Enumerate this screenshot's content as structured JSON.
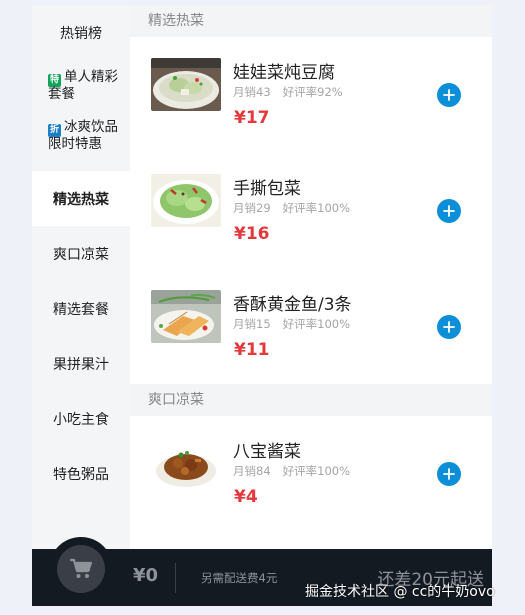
{
  "sidebar": {
    "items": [
      {
        "label": "热销榜"
      },
      {
        "tag": "特",
        "tag_color": "#10a35a",
        "label": "单人精彩套餐"
      },
      {
        "tag": "折",
        "tag_color": "#1a7fc6",
        "label": "冰爽饮品限时特惠"
      },
      {
        "label": "精选热菜",
        "active": true
      },
      {
        "label": "爽口凉菜"
      },
      {
        "label": "精选套餐"
      },
      {
        "label": "果拼果汁"
      },
      {
        "label": "小吃主食"
      },
      {
        "label": "特色粥品"
      }
    ]
  },
  "sections": [
    {
      "title": "精选热菜",
      "dishes": [
        {
          "name": "娃娃菜炖豆腐",
          "sales": "月销43",
          "rating": "好评率92%",
          "price": "¥17",
          "icon": "tofu-cabbage-dish"
        },
        {
          "name": "手撕包菜",
          "sales": "月销29",
          "rating": "好评率100%",
          "price": "¥16",
          "icon": "cabbage-dish"
        },
        {
          "name": "香酥黄金鱼/3条",
          "sales": "月销15",
          "rating": "好评率100%",
          "price": "¥11",
          "icon": "fried-fish-dish"
        }
      ]
    },
    {
      "title": "爽口凉菜",
      "dishes": [
        {
          "name": "八宝酱菜",
          "sales": "月销84",
          "rating": "好评率100%",
          "price": "¥4",
          "icon": "pickled-vegetables-dish"
        }
      ]
    }
  ],
  "cart": {
    "total": "¥0",
    "delivery_note": "另需配送费4元",
    "min_order_note": "还差20元起送"
  },
  "watermark": "掘金技术社区 @ cc的牛奶ovo",
  "colors": {
    "accent": "#0c8fd8",
    "price": "#e4393c",
    "cart_bar": "#131a22"
  }
}
